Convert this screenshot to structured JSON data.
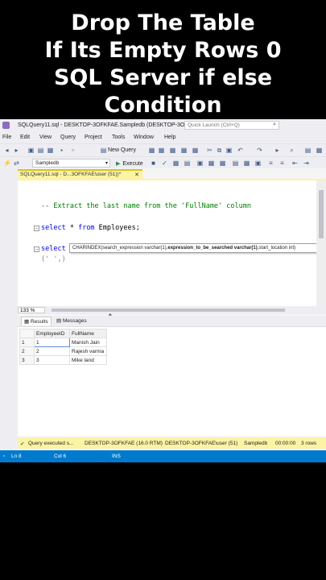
{
  "overlay_title": {
    "line1": "Drop The Table",
    "line2": "If Its Empty Rows 0",
    "line3": "SQL Server if else",
    "line4": "Condition"
  },
  "window": {
    "title": "SQLQuery11.sql - DESKTOP-3OFKFAE.Sampledb (DESKTOP-3OFK...",
    "quick_launch_placeholder": "Quick Launch (Ctrl+Q)"
  },
  "menu": [
    "File",
    "Edit",
    "View",
    "Query",
    "Project",
    "Tools",
    "Window",
    "Help"
  ],
  "toolbar": {
    "new_query_label": "New Query",
    "database": "Sampledb",
    "execute_label": "Execute"
  },
  "tab": {
    "label": "SQLQuery11.sql - D...3OFKFAE\\user (51))*",
    "close": "✕"
  },
  "editor": {
    "comment": "-- Extract the last name from the 'FullName' column",
    "line2_kw1": "select",
    "line2_mid": " * ",
    "line2_kw2": "from",
    "line2_rest": " Employees;",
    "line3_kw": "select",
    "line4": "(' ',)",
    "tooltip_pre": "CHARINDEX(search_expression varchar(1),",
    "tooltip_bold": "expression_to_be_searched varchar(1)",
    "tooltip_post": ",start_location int)"
  },
  "zoom": "133 %",
  "results_tabs": {
    "results": "Results",
    "messages": "Messages"
  },
  "grid": {
    "columns": [
      "EmployeeID",
      "FullName"
    ],
    "rows": [
      {
        "n": "1",
        "id": "1",
        "name": "Manish Jain"
      },
      {
        "n": "2",
        "id": "2",
        "name": "Rajesh varma"
      },
      {
        "n": "3",
        "id": "3",
        "name": "Mike land"
      }
    ]
  },
  "status": {
    "message": "Query executed s...",
    "server": "DESKTOP-3OFKFAE (16.0 RTM)",
    "user": "DESKTOP-3OFKFAE\\user (51)",
    "db": "Sampledb",
    "time": "00:00:00",
    "rows": "3 rows"
  },
  "bottom": {
    "ln": "Ln 8",
    "col": "Col 6",
    "ins": "INS"
  },
  "colors": {
    "accent": "#007acc",
    "tab_yellow": "#fcf3a5",
    "keyword": "#0000ff",
    "comment": "#008000"
  }
}
